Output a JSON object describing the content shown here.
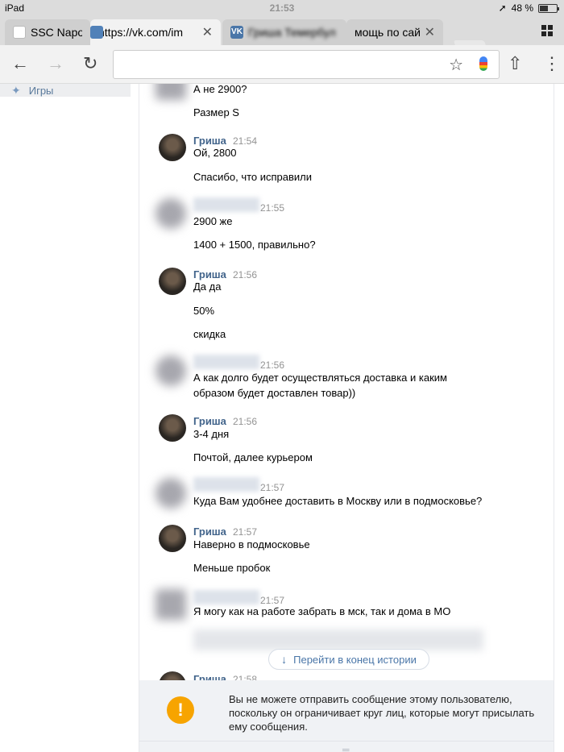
{
  "status_bar": {
    "device": "iPad",
    "time": "21:53",
    "battery": "48 %",
    "battery_level": 0.48
  },
  "tabs": [
    {
      "title": "SSC Napoli|С",
      "favicon": "blank"
    },
    {
      "title": "https://vk.com/im",
      "favicon": "vk-messages"
    },
    {
      "title": "Гриша Темербул",
      "favicon": "vk"
    },
    {
      "title": "мощь по сайт",
      "favicon": "none"
    }
  ],
  "toolbar": {
    "url": ""
  },
  "sidebar": {
    "items": [
      {
        "label": "Игры",
        "icon": "gamepad-icon"
      }
    ]
  },
  "messages": [
    {
      "author": "",
      "time": "",
      "lines": [
        "А не 2900?",
        "Размер S"
      ]
    },
    {
      "author": "Гриша",
      "time": "21:54",
      "lines": [
        "Ой, 2800",
        "Спасибо, что исправили"
      ]
    },
    {
      "author": "",
      "time": "21:55",
      "lines": [
        "2900 же",
        "1400 + 1500, правильно?"
      ]
    },
    {
      "author": "Гриша",
      "time": "21:56",
      "lines": [
        "Да да",
        "50%",
        "скидка"
      ]
    },
    {
      "author": "",
      "time": "21:56",
      "lines": [
        "А как долго будет осуществляться доставка и каким",
        "образом будет доставлен товар))"
      ]
    },
    {
      "author": "Гриша",
      "time": "21:56",
      "lines": [
        "3-4 дня",
        "Почтой, далее курьером"
      ]
    },
    {
      "author": "",
      "time": "21:57",
      "lines": [
        "Куда Вам удобнее доставить в Москву или в подмосковье?"
      ]
    },
    {
      "author": "Гриша",
      "time": "21:57",
      "lines": [
        "Наверно в подмосковье",
        "Меньше пробок"
      ]
    },
    {
      "author": "",
      "time": "21:57",
      "lines": [
        "Я могу как на работе забрать в мск, так и дома в МО"
      ]
    },
    {
      "author": "Гриша",
      "time": "21:58",
      "lines": []
    }
  ],
  "goto_end": "Перейти в конец истории",
  "warning": {
    "text": "Вы не можете отправить сообщение этому пользователю, поскольку он ограничивает круг лиц, которые могут присылать ему сообщения.",
    "icon": "!",
    "color": "#f7a400"
  },
  "colors": {
    "link": "#42648b",
    "accent": "#4a76a8"
  }
}
